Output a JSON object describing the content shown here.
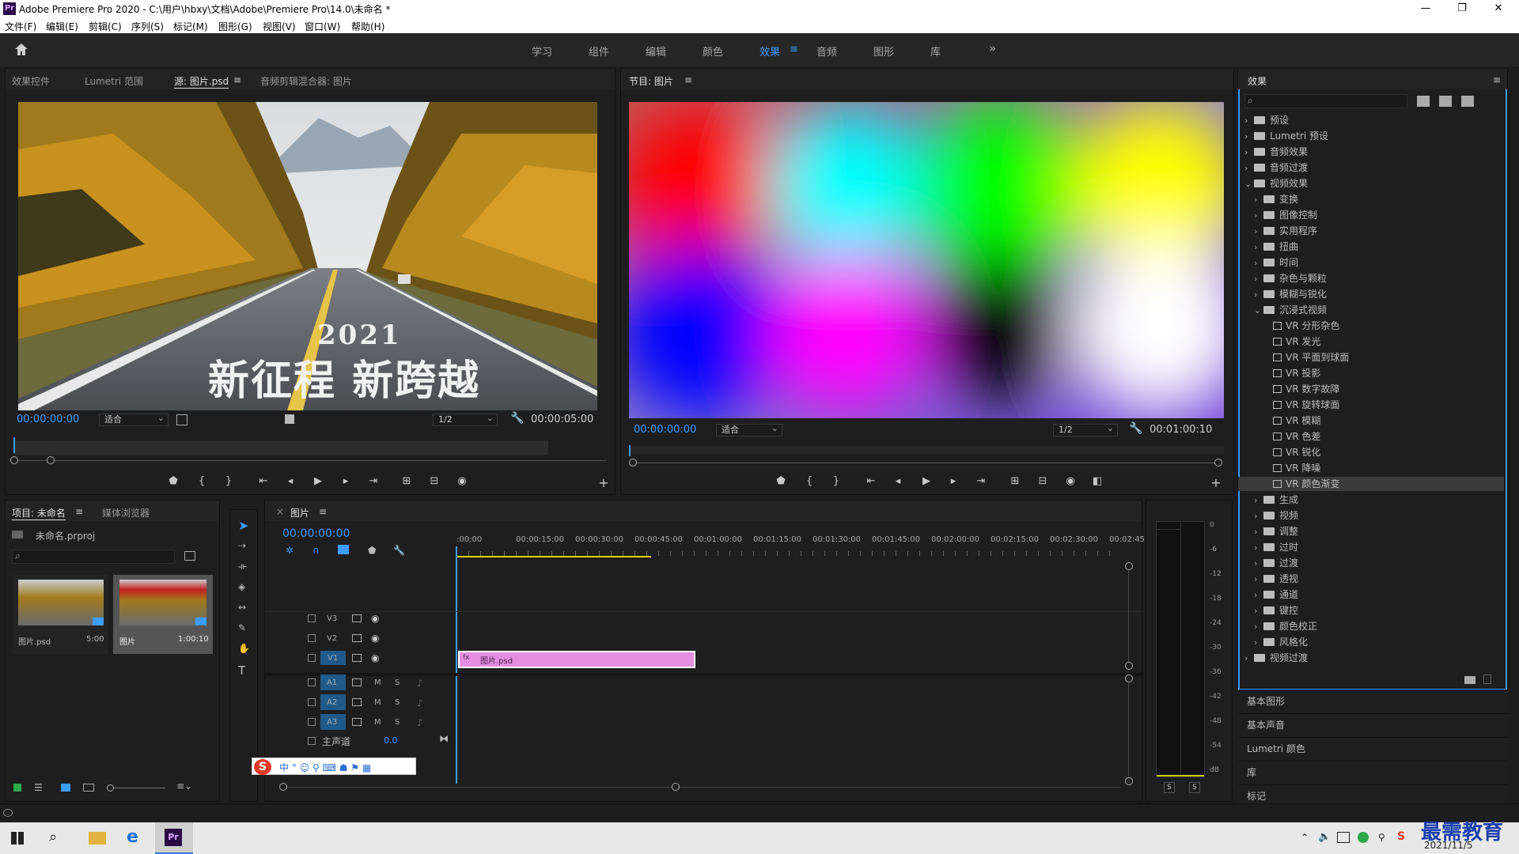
{
  "window": {
    "app_icon": "Pr",
    "title": "Adobe Premiere Pro 2020 - C:\\用户\\hbxy\\文档\\Adobe\\Premiere Pro\\14.0\\未命名 *",
    "minimize": "—",
    "maximize": "❐",
    "close": "✕"
  },
  "menu": [
    "文件(F)",
    "编辑(E)",
    "剪辑(C)",
    "序列(S)",
    "标记(M)",
    "图形(G)",
    "视图(V)",
    "窗口(W)",
    "帮助(H)"
  ],
  "workspaces": {
    "items": [
      "学习",
      "组件",
      "编辑",
      "颜色",
      "效果",
      "音频",
      "图形",
      "库"
    ],
    "active": "效果",
    "more": "»"
  },
  "source_panel": {
    "tabs": [
      "效果控件",
      "Lumetri 范围",
      "源: 图片.psd",
      "音频剪辑混合器: 图片"
    ],
    "active_tab": "源: 图片.psd",
    "overlay_year": "2021",
    "overlay_text": "新征程 新跨越",
    "timecode": "00:00:00:00",
    "fit": "适合",
    "resolution": "1/2",
    "duration": "00:00:05:00"
  },
  "program_panel": {
    "tab": "节目: 图片",
    "timecode": "00:00:00:00",
    "fit": "适合",
    "resolution": "1/2",
    "duration": "00:01:00:10"
  },
  "effects_panel": {
    "title": "效果",
    "tree": [
      {
        "label": "预设",
        "level": 0,
        "type": "folder",
        "expanded": false
      },
      {
        "label": "Lumetri 预设",
        "level": 0,
        "type": "folder",
        "expanded": false
      },
      {
        "label": "音频效果",
        "level": 0,
        "type": "folder",
        "expanded": false
      },
      {
        "label": "音频过渡",
        "level": 0,
        "type": "folder",
        "expanded": false
      },
      {
        "label": "视频效果",
        "level": 0,
        "type": "folder",
        "expanded": true
      },
      {
        "label": "变换",
        "level": 1,
        "type": "folder",
        "expanded": false
      },
      {
        "label": "图像控制",
        "level": 1,
        "type": "folder",
        "expanded": false
      },
      {
        "label": "实用程序",
        "level": 1,
        "type": "folder",
        "expanded": false
      },
      {
        "label": "扭曲",
        "level": 1,
        "type": "folder",
        "expanded": false
      },
      {
        "label": "时间",
        "level": 1,
        "type": "folder",
        "expanded": false
      },
      {
        "label": "杂色与颗粒",
        "level": 1,
        "type": "folder",
        "expanded": false
      },
      {
        "label": "模糊与锐化",
        "level": 1,
        "type": "folder",
        "expanded": false
      },
      {
        "label": "沉浸式视频",
        "level": 1,
        "type": "folder",
        "expanded": true
      },
      {
        "label": "VR 分形杂色",
        "level": 2,
        "type": "effect"
      },
      {
        "label": "VR 发光",
        "level": 2,
        "type": "effect"
      },
      {
        "label": "VR 平面到球面",
        "level": 2,
        "type": "effect"
      },
      {
        "label": "VR 投影",
        "level": 2,
        "type": "effect"
      },
      {
        "label": "VR 数字故障",
        "level": 2,
        "type": "effect"
      },
      {
        "label": "VR 旋转球面",
        "level": 2,
        "type": "effect"
      },
      {
        "label": "VR 模糊",
        "level": 2,
        "type": "effect"
      },
      {
        "label": "VR 色差",
        "level": 2,
        "type": "effect"
      },
      {
        "label": "VR 锐化",
        "level": 2,
        "type": "effect"
      },
      {
        "label": "VR 降噪",
        "level": 2,
        "type": "effect"
      },
      {
        "label": "VR 颜色渐变",
        "level": 2,
        "type": "effect",
        "selected": true
      },
      {
        "label": "生成",
        "level": 1,
        "type": "folder",
        "expanded": false
      },
      {
        "label": "视频",
        "level": 1,
        "type": "folder",
        "expanded": false
      },
      {
        "label": "调整",
        "level": 1,
        "type": "folder",
        "expanded": false
      },
      {
        "label": "过时",
        "level": 1,
        "type": "folder",
        "expanded": false
      },
      {
        "label": "过渡",
        "level": 1,
        "type": "folder",
        "expanded": false
      },
      {
        "label": "透视",
        "level": 1,
        "type": "folder",
        "expanded": false
      },
      {
        "label": "通道",
        "level": 1,
        "type": "folder",
        "expanded": false
      },
      {
        "label": "键控",
        "level": 1,
        "type": "folder",
        "expanded": false
      },
      {
        "label": "颜色校正",
        "level": 1,
        "type": "folder",
        "expanded": false
      },
      {
        "label": "风格化",
        "level": 1,
        "type": "folder",
        "expanded": false
      },
      {
        "label": "视频过渡",
        "level": 0,
        "type": "folder",
        "expanded": false
      }
    ],
    "collapsed_panels": [
      "基本图形",
      "基本声音",
      "Lumetri 颜色",
      "库",
      "标记"
    ]
  },
  "project_panel": {
    "tabs": [
      "项目: 未命名",
      "媒体浏览器"
    ],
    "project_file": "未命名.prproj",
    "items": [
      {
        "name": "图片.psd",
        "duration": "5:00"
      },
      {
        "name": "图片",
        "duration": "1:00:10"
      }
    ]
  },
  "timeline": {
    "tab": "图片",
    "timecode": "00:00:00:00",
    "ruler": [
      ":00:00",
      "00:00:15:00",
      "00:00:30:00",
      "00:00:45:00",
      "00:01:00:00",
      "00:01:15:00",
      "00:01:30:00",
      "00:01:45:00",
      "00:02:00:00",
      "00:02:15:00",
      "00:02:30:00",
      "00:02:45:"
    ],
    "video_tracks": [
      "V3",
      "V2",
      "V1"
    ],
    "audio_tracks": [
      "A1",
      "A2",
      "A3"
    ],
    "mute_label": "M",
    "solo_label": "S",
    "master": {
      "label": "主声道",
      "value": "0.0"
    },
    "clip": {
      "name": "图片.psd",
      "fx": "fx"
    }
  },
  "audio_meter": {
    "scale": [
      "0",
      "-6",
      "-12",
      "-18",
      "-24",
      "-30",
      "-36",
      "-42",
      "-48",
      "-54",
      "dB"
    ],
    "solo_labels": [
      "S",
      "S"
    ]
  },
  "taskbar": {
    "date": "2021/11/5",
    "watermark": "最需教育"
  },
  "colors": {
    "accent": "#3d9dff",
    "clip": "#e38ee0",
    "yellow_bar": "#e0d000"
  }
}
